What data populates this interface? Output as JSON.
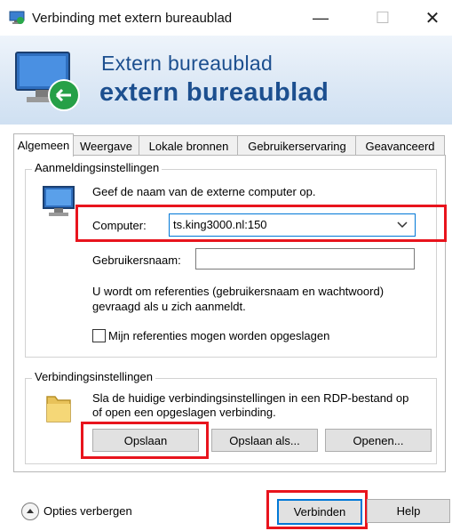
{
  "window": {
    "title": "Verbinding met extern bureaublad",
    "minimize_glyph": "—",
    "maximize_glyph": "☐",
    "close_glyph": "✕"
  },
  "banner": {
    "subtitle": "Extern bureaublad",
    "title": "extern bureaublad"
  },
  "tabs": [
    {
      "label": "Algemeen",
      "active": true
    },
    {
      "label": "Weergave",
      "active": false
    },
    {
      "label": "Lokale bronnen",
      "active": false
    },
    {
      "label": "Gebruikerservaring",
      "active": false
    },
    {
      "label": "Geavanceerd",
      "active": false
    }
  ],
  "logon": {
    "legend": "Aanmeldingsinstellingen",
    "instruction": "Geef de naam van de externe computer op.",
    "computer_label": "Computer:",
    "computer_value": "ts.king3000.nl:150",
    "username_label": "Gebruikersnaam:",
    "username_value": "",
    "info_line1": "U wordt om referenties (gebruikersnaam en wachtwoord)",
    "info_line2": "gevraagd als u zich aanmeldt.",
    "save_credentials_label": "Mijn referenties mogen worden opgeslagen",
    "save_credentials_checked": false
  },
  "connection": {
    "legend": "Verbindingsinstellingen",
    "desc_line1": "Sla de huidige verbindingsinstellingen in een RDP-bestand op",
    "desc_line2": "of open een opgeslagen verbinding.",
    "save_label": "Opslaan",
    "save_as_label": "Opslaan als...",
    "open_label": "Openen..."
  },
  "footer": {
    "options_label": "Opties verbergen",
    "connect_label": "Verbinden",
    "help_label": "Help"
  },
  "colors": {
    "highlight": "#e8141d",
    "banner_text": "#1c4f8f"
  },
  "icons": [
    "remote-desktop-icon",
    "monitor-icon",
    "folder-icon",
    "chevron-down-icon",
    "chevron-up-icon"
  ]
}
